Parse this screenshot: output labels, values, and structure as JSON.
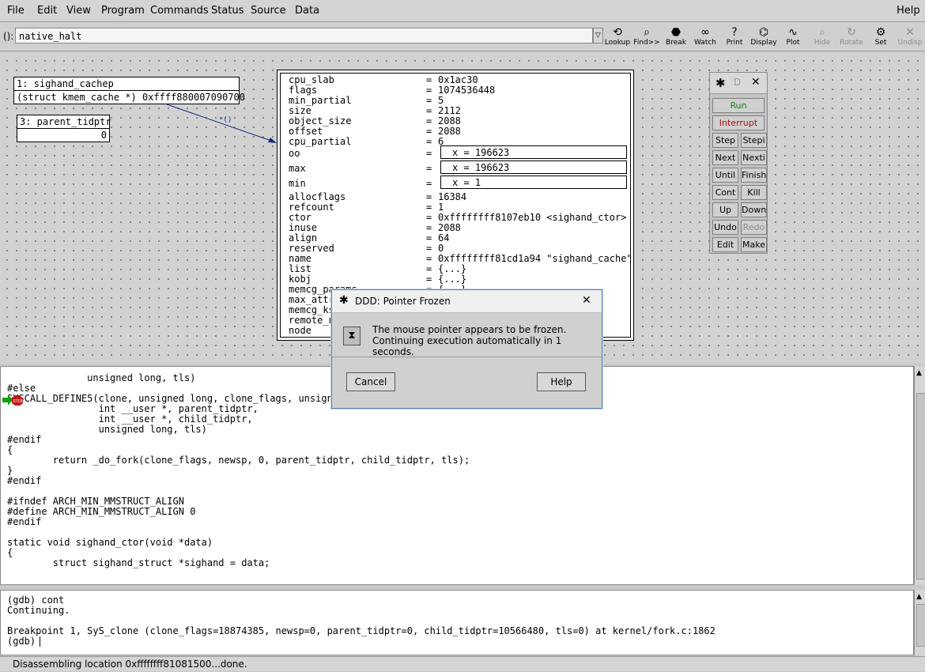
{
  "menubar": {
    "items": [
      "File",
      "Edit",
      "View",
      "Program",
      "Commands",
      "Status",
      "Source",
      "Data"
    ],
    "help": "Help"
  },
  "toolbar": {
    "arg_label": "():",
    "arg_value": "native_halt",
    "dropdown_glyph": "▽",
    "tools": [
      {
        "label": "Lookup",
        "icon": "lookup-icon",
        "glyph": "⟲",
        "enabled": true
      },
      {
        "label": "Find>>",
        "icon": "binoculars-icon",
        "glyph": "⌕",
        "enabled": true
      },
      {
        "label": "Break",
        "icon": "stop-sign-icon",
        "glyph": "⬣",
        "enabled": true
      },
      {
        "label": "Watch",
        "icon": "glasses-icon",
        "glyph": "∞",
        "enabled": true
      },
      {
        "label": "Print",
        "icon": "question-icon",
        "glyph": "?",
        "enabled": true
      },
      {
        "label": "Display",
        "icon": "display-icon",
        "glyph": "⌬",
        "enabled": true
      },
      {
        "label": "Plot",
        "icon": "plot-icon",
        "glyph": "∿",
        "enabled": true
      },
      {
        "label": "Hide",
        "icon": "magnifier-icon",
        "glyph": "⌕",
        "enabled": false
      },
      {
        "label": "Rotate",
        "icon": "rotate-icon",
        "glyph": "↻",
        "enabled": false
      },
      {
        "label": "Set",
        "icon": "set-icon",
        "glyph": "⚙",
        "enabled": true
      },
      {
        "label": "Undisp",
        "icon": "undisplay-icon",
        "glyph": "✕",
        "enabled": false
      }
    ]
  },
  "displays": {
    "d1_header": "1: sighand_cachep",
    "d1_value": "(struct kmem_cache *) 0xffff880007090700",
    "d3_header": "3: parent_tidptr",
    "d3_value": "0",
    "arrow_label": "*()",
    "struct_fields": [
      {
        "name": "cpu_slab",
        "value": "0x1ac30"
      },
      {
        "name": "flags",
        "value": "1074536448"
      },
      {
        "name": "min_partial",
        "value": "5"
      },
      {
        "name": "size",
        "value": "2112"
      },
      {
        "name": "object_size",
        "value": "2088"
      },
      {
        "name": "offset",
        "value": "2088"
      },
      {
        "name": "cpu_partial",
        "value": "6"
      }
    ],
    "struct_boxed": [
      {
        "name": "oo",
        "value": "x = 196623"
      },
      {
        "name": "max",
        "value": "x = 196623"
      },
      {
        "name": "min",
        "value": "x = 1"
      }
    ],
    "struct_fields2": [
      {
        "name": "allocflags",
        "value": "16384"
      },
      {
        "name": "refcount",
        "value": "1"
      },
      {
        "name": "ctor",
        "value": "0xffffffff8107eb10 <sighand_ctor>"
      },
      {
        "name": "inuse",
        "value": "2088"
      },
      {
        "name": "align",
        "value": "64"
      },
      {
        "name": "reserved",
        "value": "0"
      },
      {
        "name": "name",
        "value": "0xffffffff81cd1a94 \"sighand_cache\""
      },
      {
        "name": "list",
        "value": "{...}"
      },
      {
        "name": "kobj",
        "value": "{...}"
      },
      {
        "name": "memcg_params",
        "value": "{...}"
      },
      {
        "name": "max_attr_size",
        "value": ""
      },
      {
        "name": "memcg_kset",
        "value": ""
      },
      {
        "name": "remote_node_defrag_ratio",
        "value": ""
      },
      {
        "name": "node",
        "value": ""
      }
    ]
  },
  "cmdtool": {
    "title": "D",
    "buttons": [
      [
        "Run"
      ],
      [
        "Interrupt"
      ],
      [
        "Step",
        "Stepi"
      ],
      [
        "Next",
        "Nexti"
      ],
      [
        "Until",
        "Finish"
      ],
      [
        "Cont",
        "Kill"
      ],
      [
        "Up",
        "Down"
      ],
      [
        "Undo",
        "Redo"
      ],
      [
        "Edit",
        "Make"
      ]
    ]
  },
  "source": {
    "lines": [
      "              unsigned long, tls)",
      "#else",
      "SYSCALL_DEFINE5(clone, unsigned long, clone_flags, unsigned",
      "                int __user *, parent_tidptr,",
      "                int __user *, child_tidptr,",
      "                unsigned long, tls)",
      "#endif",
      "{",
      "        return _do_fork(clone_flags, newsp, 0, parent_tidptr, child_tidptr, tls);",
      "}",
      "#endif",
      "",
      "#ifndef ARCH_MIN_MMSTRUCT_ALIGN",
      "#define ARCH_MIN_MMSTRUCT_ALIGN 0",
      "#endif",
      "",
      "static void sighand_ctor(void *data)",
      "{",
      "        struct sighand_struct *sighand = data;"
    ],
    "breakpoint_label": "STOP"
  },
  "console": {
    "lines": [
      "(gdb) cont",
      "Continuing.",
      "",
      "Breakpoint 1, SyS_clone (clone_flags=18874385, newsp=0, parent_tidptr=0, child_tidptr=10566480, tls=0) at kernel/fork.c:1862",
      "(gdb) "
    ]
  },
  "status": "Disassembling location 0xffffffff81081500...done.",
  "dialog": {
    "title": "DDD: Pointer Frozen",
    "message_line1": "The mouse pointer appears to be frozen.",
    "message_line2": "Continuing execution automatically in 1 seconds.",
    "cancel": "Cancel",
    "help": "Help",
    "close_glyph": "✕"
  },
  "colors": {
    "run": "#1a7f1a",
    "interrupt": "#b01010",
    "stop_sign": "#c01818",
    "exec_arrow": "#10a010",
    "disabled": "#8c8c8c"
  }
}
